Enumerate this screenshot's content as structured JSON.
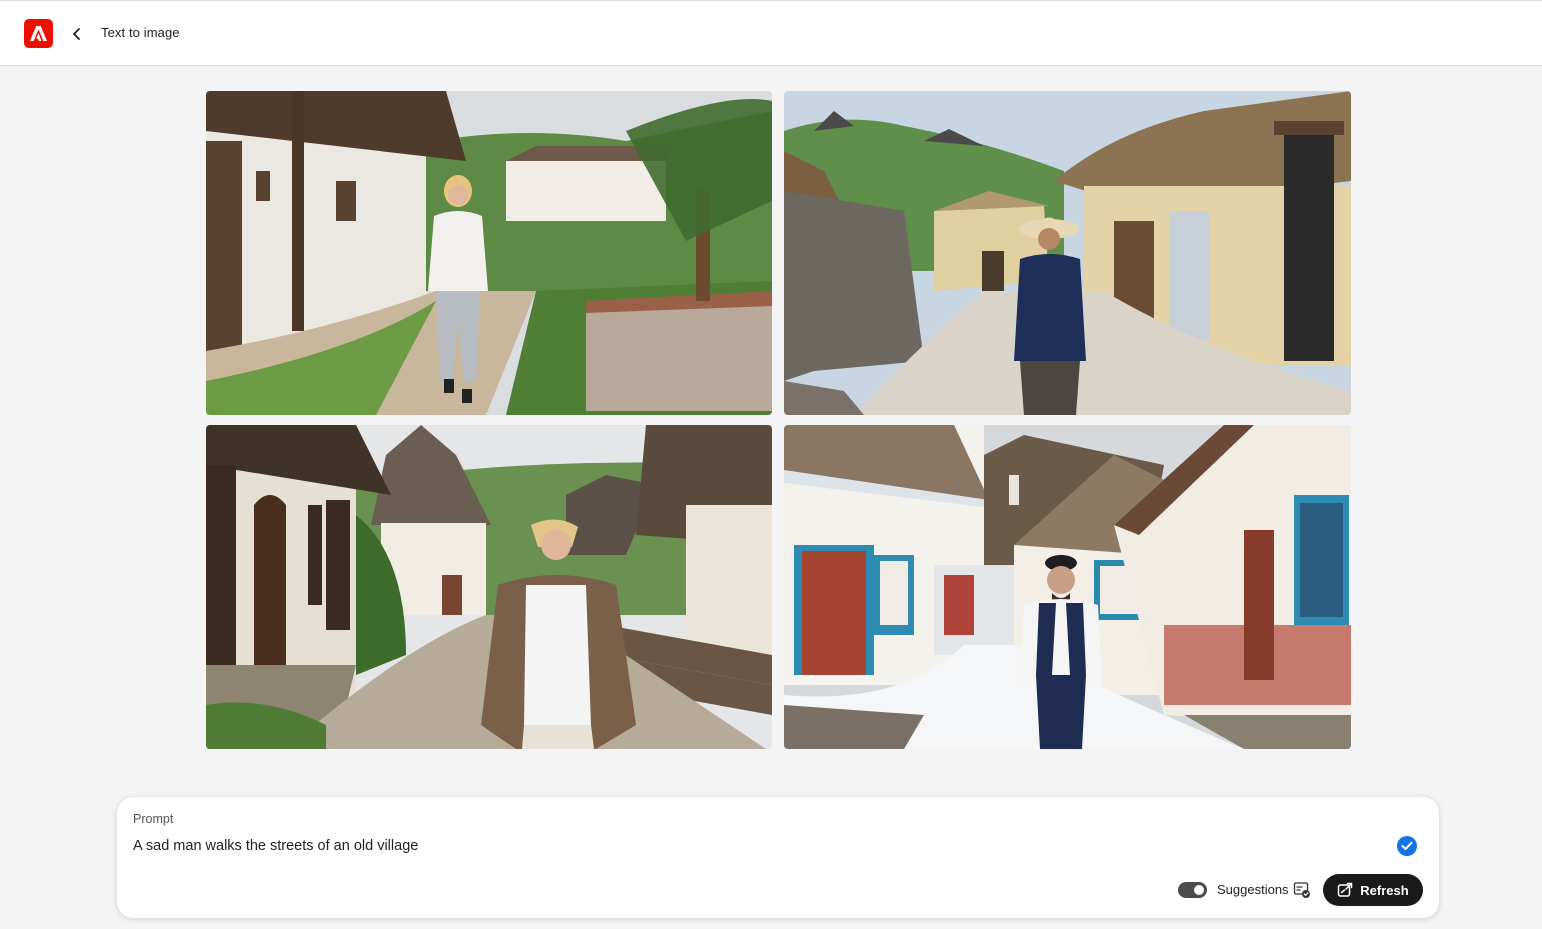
{
  "header": {
    "title": "Text to image"
  },
  "gallery": {
    "images": [
      {
        "name": "generated-image-1"
      },
      {
        "name": "generated-image-2"
      },
      {
        "name": "generated-image-3"
      },
      {
        "name": "generated-image-4"
      }
    ]
  },
  "prompt": {
    "label": "Prompt",
    "value": "A sad man walks the streets of an old village"
  },
  "controls": {
    "suggestions_label": "Suggestions",
    "suggestions_on": true,
    "refresh_label": "Refresh"
  },
  "colors": {
    "brand": "#eb1000",
    "accent": "#1473e6",
    "button": "#1a1a1a"
  },
  "icons": [
    "adobe-logo-icon",
    "chevron-left-icon",
    "check-circle-icon",
    "suggestions-icon",
    "refresh-icon"
  ]
}
